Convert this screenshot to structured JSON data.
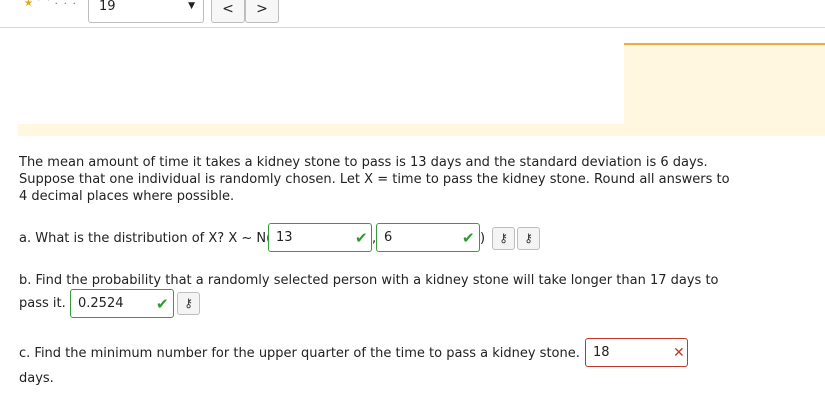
{
  "toolbar": {
    "question_select_value": "19",
    "prev_label": "<",
    "next_label": ">"
  },
  "problem": {
    "text": "The mean amount of time it takes a kidney stone to pass is 13 days and the standard deviation is 6 days. Suppose that one individual is randomly chosen. Let X = time to pass the kidney stone. Round all answers to 4 decimal places where possible."
  },
  "part_a": {
    "prompt": "a. What is the distribution of X? X ~ N(",
    "mean_value": "13",
    "sep": ",",
    "sd_value": "6",
    "close": ")"
  },
  "part_b": {
    "prompt_line1": "b. Find the probability that a randomly selected person with a kidney stone will take longer than 17 days to",
    "prompt_line2": "pass it.",
    "answer_value": "0.2524"
  },
  "part_c": {
    "prompt": "c. Find the minimum number for the upper quarter of the time to pass a kidney stone.",
    "answer_value": "18",
    "suffix": "days."
  },
  "colors": {
    "correct": "#3a9b3a",
    "incorrect": "#c0392b",
    "banner": "#fff7df",
    "banner_accent": "#f2a93b"
  }
}
